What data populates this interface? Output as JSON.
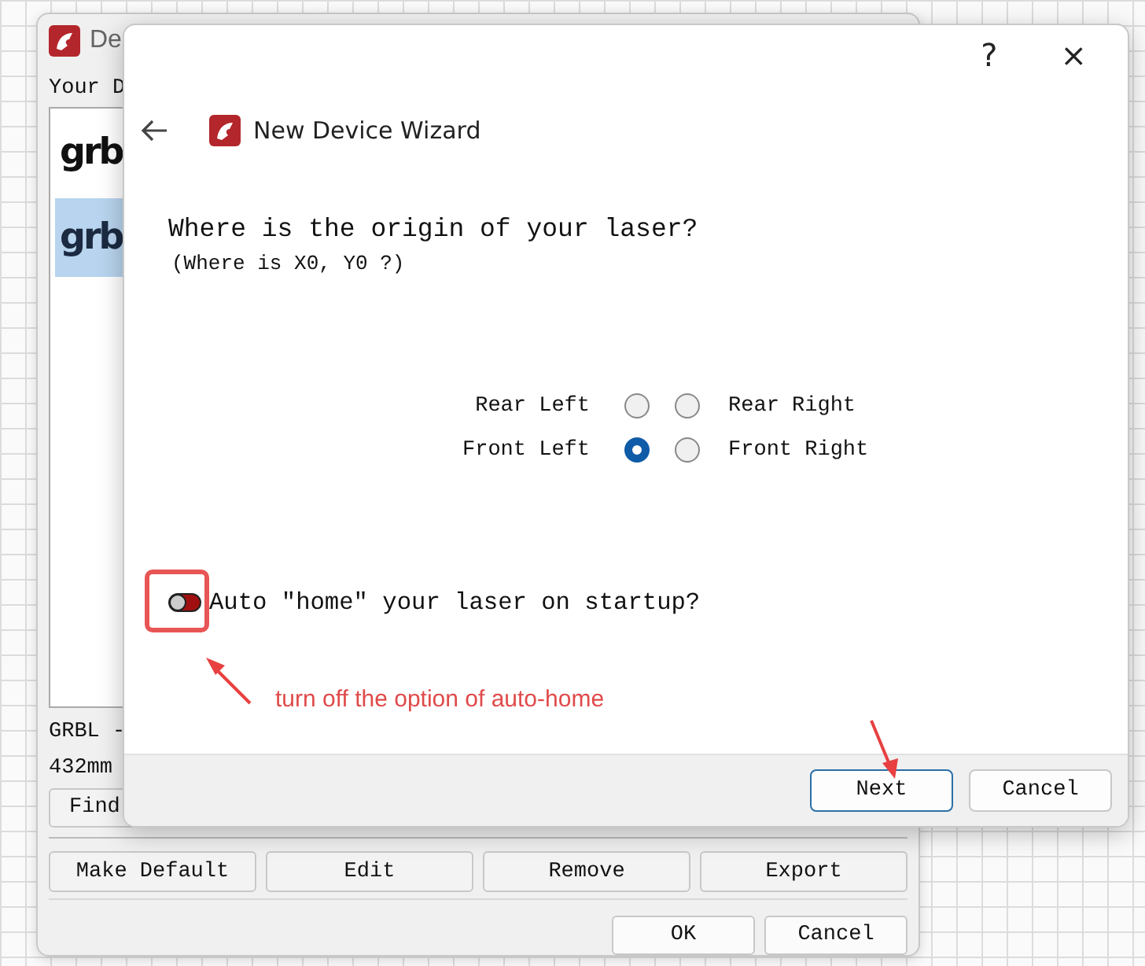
{
  "background_window": {
    "title": "De",
    "list_label": "Your D",
    "devices": [
      {
        "logo": "grb",
        "selected": false
      },
      {
        "logo": "grb",
        "selected": true
      }
    ],
    "info_lines": [
      "GRBL -",
      "432mm"
    ],
    "find_button": "Find",
    "buttons": [
      "Make Default",
      "Edit",
      "Remove",
      "Export"
    ],
    "dialog_buttons": [
      "OK",
      "Cancel"
    ]
  },
  "wizard": {
    "help": "?",
    "close": "×",
    "title": "New Device Wizard",
    "question": "Where is the origin of your laser?",
    "hint": "(Where is X0, Y0 ?)",
    "origins": [
      {
        "label": "Rear Left",
        "selected": false
      },
      {
        "label": "Rear Right",
        "selected": false
      },
      {
        "label": "Front Left",
        "selected": true
      },
      {
        "label": "Front Right",
        "selected": false
      }
    ],
    "auto_home": {
      "label": "Auto ″home″ your laser on startup?",
      "on": false
    },
    "buttons": [
      {
        "label": "Next",
        "default": true
      },
      {
        "label": "Cancel",
        "default": false
      }
    ]
  },
  "annotation": {
    "text": "turn off the option of auto-home"
  }
}
